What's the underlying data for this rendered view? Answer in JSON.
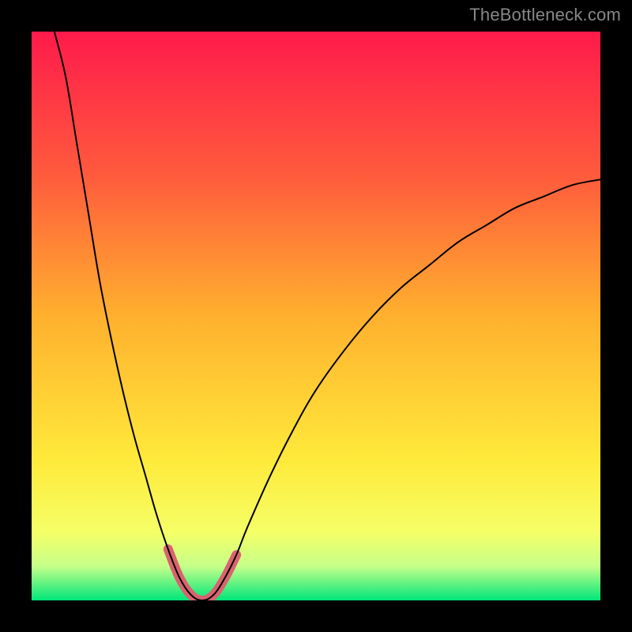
{
  "watermark": "TheBottleneck.com",
  "chart_data": {
    "type": "line",
    "title": "",
    "xlabel": "",
    "ylabel": "",
    "xlim": [
      0,
      100
    ],
    "ylim": [
      0,
      100
    ],
    "grid": false,
    "legend": false,
    "background_gradient": {
      "stops": [
        {
          "offset": 0.0,
          "color": "#ff1a4b"
        },
        {
          "offset": 0.25,
          "color": "#ff5a3d"
        },
        {
          "offset": 0.5,
          "color": "#ffb02e"
        },
        {
          "offset": 0.75,
          "color": "#ffe93a"
        },
        {
          "offset": 0.88,
          "color": "#f5ff66"
        },
        {
          "offset": 0.94,
          "color": "#c6ff8a"
        },
        {
          "offset": 1.0,
          "color": "#00e67a"
        }
      ]
    },
    "series": [
      {
        "name": "bottleneck-curve",
        "color": "#000000",
        "stroke_width": 2,
        "points": [
          {
            "x": 4,
            "y": 100
          },
          {
            "x": 6,
            "y": 92
          },
          {
            "x": 8,
            "y": 80
          },
          {
            "x": 10,
            "y": 68
          },
          {
            "x": 12,
            "y": 56
          },
          {
            "x": 14,
            "y": 46
          },
          {
            "x": 16,
            "y": 37
          },
          {
            "x": 18,
            "y": 29
          },
          {
            "x": 20,
            "y": 22
          },
          {
            "x": 22,
            "y": 15
          },
          {
            "x": 24,
            "y": 9
          },
          {
            "x": 26,
            "y": 4
          },
          {
            "x": 28,
            "y": 1
          },
          {
            "x": 30,
            "y": 0
          },
          {
            "x": 32,
            "y": 1
          },
          {
            "x": 34,
            "y": 4
          },
          {
            "x": 36,
            "y": 8
          },
          {
            "x": 38,
            "y": 13
          },
          {
            "x": 42,
            "y": 22
          },
          {
            "x": 46,
            "y": 30
          },
          {
            "x": 50,
            "y": 37
          },
          {
            "x": 55,
            "y": 44
          },
          {
            "x": 60,
            "y": 50
          },
          {
            "x": 65,
            "y": 55
          },
          {
            "x": 70,
            "y": 59
          },
          {
            "x": 75,
            "y": 63
          },
          {
            "x": 80,
            "y": 66
          },
          {
            "x": 85,
            "y": 69
          },
          {
            "x": 90,
            "y": 71
          },
          {
            "x": 95,
            "y": 73
          },
          {
            "x": 100,
            "y": 74
          }
        ]
      },
      {
        "name": "minimum-marker",
        "color": "#d9636f",
        "stroke_width": 12,
        "linecap": "round",
        "points": [
          {
            "x": 24,
            "y": 9
          },
          {
            "x": 26,
            "y": 4
          },
          {
            "x": 28,
            "y": 1
          },
          {
            "x": 30,
            "y": 0
          },
          {
            "x": 32,
            "y": 1
          },
          {
            "x": 34,
            "y": 4
          },
          {
            "x": 36,
            "y": 8
          }
        ]
      }
    ]
  }
}
